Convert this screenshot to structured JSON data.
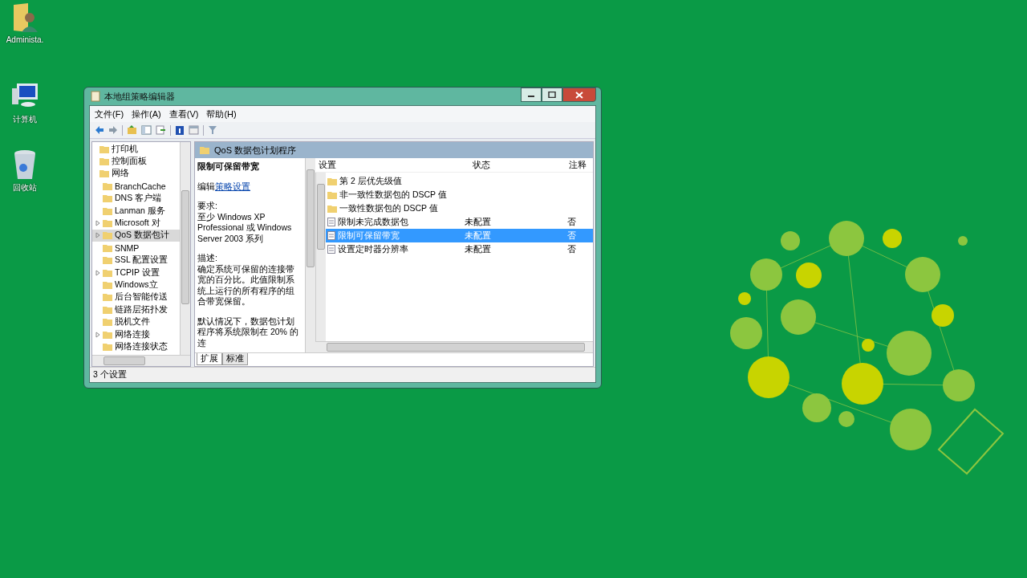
{
  "desktop": {
    "icons": [
      {
        "kind": "user-folder",
        "label": "Administa."
      },
      {
        "kind": "computer",
        "label": "计算机"
      },
      {
        "kind": "recycle-bin",
        "label": "回收站"
      }
    ]
  },
  "window": {
    "title": "本地组策略编辑器",
    "menu": [
      "文件(F)",
      "操作(A)",
      "查看(V)",
      "帮助(H)"
    ],
    "tree": [
      {
        "label": "打印机",
        "selected": false
      },
      {
        "label": "控制面板",
        "selected": false
      },
      {
        "label": "网络",
        "selected": false,
        "children": [
          {
            "label": "BranchCache",
            "expandable": false,
            "selected": false
          },
          {
            "label": "DNS 客户端",
            "expandable": false,
            "selected": false
          },
          {
            "label": "Lanman 服务",
            "expandable": false,
            "selected": false
          },
          {
            "label": "Microsoft 对",
            "expandable": true,
            "selected": false
          },
          {
            "label": "QoS 数据包计",
            "expandable": true,
            "selected": true
          },
          {
            "label": "SNMP",
            "expandable": false,
            "selected": false
          },
          {
            "label": "SSL 配置设置",
            "expandable": false,
            "selected": false
          },
          {
            "label": "TCPIP 设置",
            "expandable": true,
            "selected": false
          },
          {
            "label": "Windows立",
            "expandable": false,
            "selected": false
          },
          {
            "label": "后台智能传送",
            "expandable": false,
            "selected": false
          },
          {
            "label": "链路层拓扑发",
            "expandable": false,
            "selected": false
          },
          {
            "label": "脱机文件",
            "expandable": false,
            "selected": false
          },
          {
            "label": "网络连接",
            "expandable": true,
            "selected": false
          },
          {
            "label": "网络连接状态",
            "expandable": false,
            "selected": false
          }
        ]
      }
    ],
    "header": "QoS 数据包计划程序",
    "detail": {
      "title": "限制可保留带宽",
      "edit_prefix": "编辑",
      "edit_link": "策略设置",
      "requirements_label": "要求:",
      "requirements": "至少 Windows XP Professional 或 Windows Server 2003 系列",
      "description_label": "描述:",
      "description": "确定系统可保留的连接带宽的百分比。此值限制系统上运行的所有程序的组合带宽保留。",
      "default_text": "默认情况下，数据包计划程序将系统限制在 20% 的连"
    },
    "columns": [
      "设置",
      "状态",
      "注释"
    ],
    "rows": [
      {
        "kind": "folder",
        "name": "第 2 层优先级值",
        "selected": false
      },
      {
        "kind": "folder",
        "name": "非一致性数据包的 DSCP 值",
        "selected": false
      },
      {
        "kind": "folder",
        "name": "一致性数据包的 DSCP 值",
        "selected": false
      },
      {
        "kind": "policy",
        "name": "限制未完成数据包",
        "state": "未配置",
        "comment": "否",
        "selected": false
      },
      {
        "kind": "policy",
        "name": "限制可保留带宽",
        "state": "未配置",
        "comment": "否",
        "selected": true
      },
      {
        "kind": "policy",
        "name": "设置定时器分辨率",
        "state": "未配置",
        "comment": "否",
        "selected": false
      }
    ],
    "tabs": [
      {
        "label": "扩展",
        "selected": true
      },
      {
        "label": "标准",
        "selected": false
      }
    ],
    "status_bar": "3 个设置"
  }
}
